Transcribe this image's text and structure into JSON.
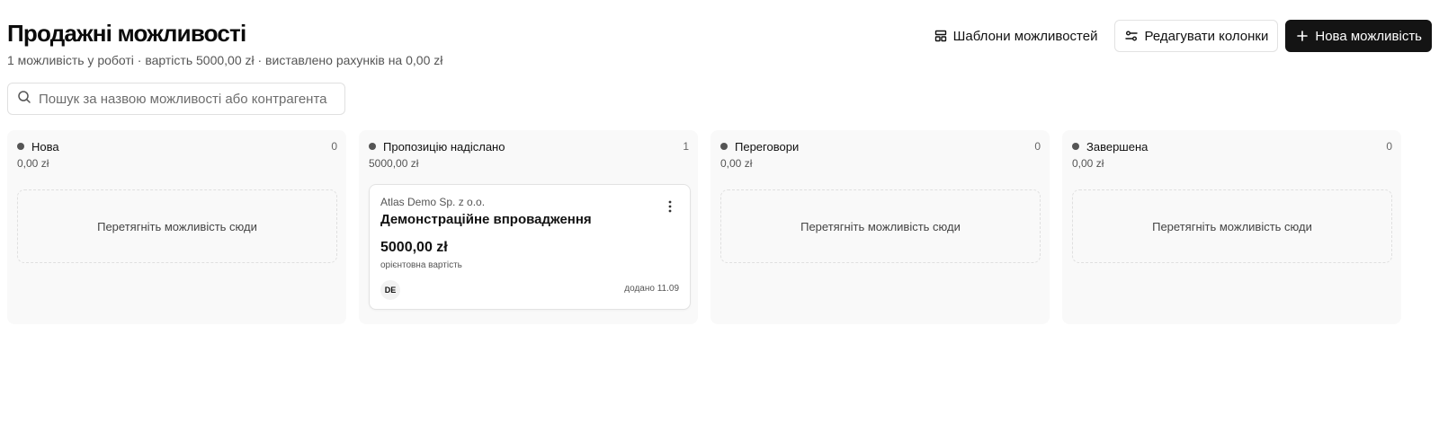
{
  "header": {
    "title": "Продажні можливості",
    "subtitle": "1 можливість у роботі · вартість 5000,00 zł · виставлено рахунків на 0,00 zł"
  },
  "actions": {
    "templates_label": "Шаблони можливостей",
    "edit_columns_label": "Редагувати колонки",
    "new_label": "Нова можливість"
  },
  "search": {
    "placeholder": "Пошук за назвою можливості або контрагента"
  },
  "columns": [
    {
      "name": "Нова",
      "count": "0",
      "sum": "0,00 zł",
      "empty_text": "Перетягніть можливість сюди"
    },
    {
      "name": "Пропозицію надіслано",
      "count": "1",
      "sum": "5000,00 zł"
    },
    {
      "name": "Переговори",
      "count": "0",
      "sum": "0,00 zł",
      "empty_text": "Перетягніть можливість сюди"
    },
    {
      "name": "Завершена",
      "count": "0",
      "sum": "0,00 zł",
      "empty_text": "Перетягніть можливість сюди"
    }
  ],
  "card": {
    "company": "Atlas Demo Sp. z o.o.",
    "title": "Демонстраційне впровадження",
    "value": "5000,00 zł",
    "value_label": "орієнтовна вартість",
    "avatar_initials": "DE",
    "added": "додано 11.09"
  },
  "colors": {
    "primary_button": "#141414",
    "column_bg": "#f9f9f9",
    "dot": "#555555"
  }
}
